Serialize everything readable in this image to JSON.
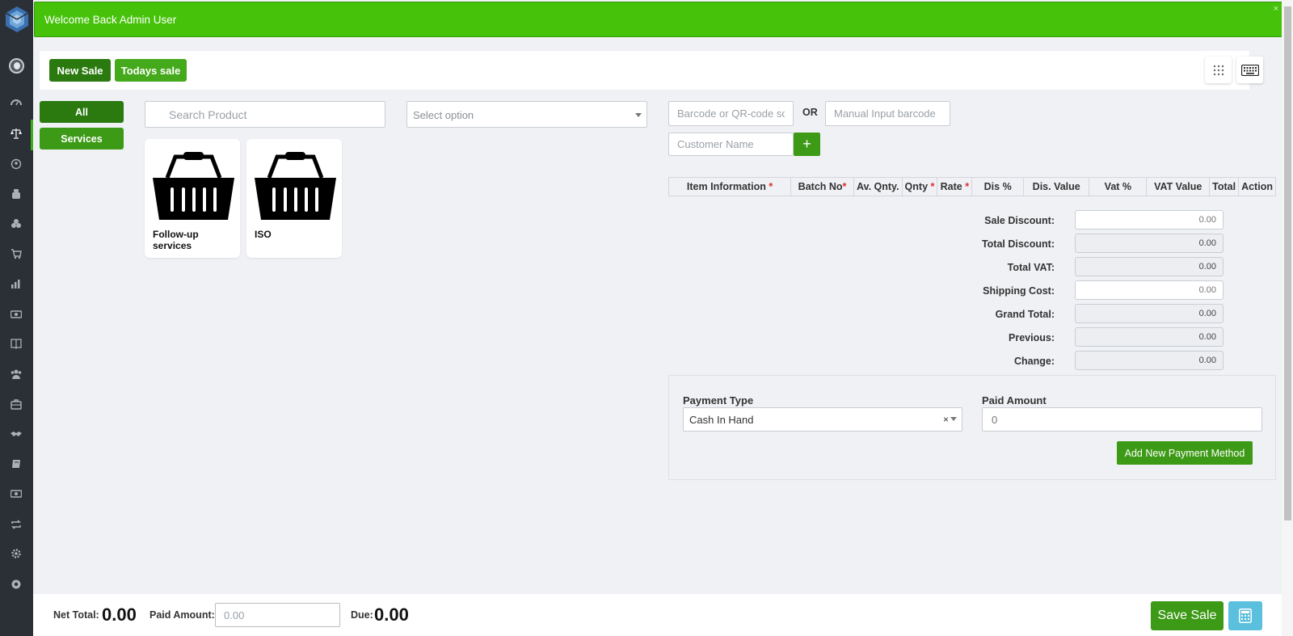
{
  "alert": {
    "message": "Welcome Back Admin User",
    "close": "×"
  },
  "toolbar": {
    "new_sale": "New Sale",
    "todays_sale": "Todays sale"
  },
  "categories": [
    "All",
    "Services"
  ],
  "search": {
    "placeholder": "Search Product"
  },
  "category_select": {
    "value": "Select option"
  },
  "products": [
    {
      "name": "Follow-up services",
      "icon": "shopping-basket-icon"
    },
    {
      "name": "ISO",
      "icon": "shopping-basket-icon"
    }
  ],
  "barcode": {
    "placeholder": "Barcode or QR-code scan here",
    "or_label": "OR",
    "manual_placeholder": "Manual Input barcode"
  },
  "customer": {
    "placeholder": "Customer Name",
    "add": "+"
  },
  "items_table": {
    "headers": [
      {
        "label": "Item Information",
        "required": true
      },
      {
        "label": "Batch No",
        "required": true,
        "tight": true
      },
      {
        "label": "Av. Qnty.",
        "required": false
      },
      {
        "label": "Qnty",
        "required": true
      },
      {
        "label": "Rate",
        "required": true
      },
      {
        "label": "Dis %",
        "required": false
      },
      {
        "label": "Dis. Value",
        "required": false
      },
      {
        "label": "Vat %",
        "required": false
      },
      {
        "label": "VAT Value",
        "required": false
      },
      {
        "label": "Total",
        "required": false
      },
      {
        "label": "Action",
        "required": false
      }
    ]
  },
  "totals": [
    {
      "label": "Sale Discount:",
      "value": "0.00",
      "readonly": false
    },
    {
      "label": "Total Discount:",
      "value": "0.00",
      "readonly": true
    },
    {
      "label": "Total VAT:",
      "value": "0.00",
      "readonly": true
    },
    {
      "label": "Shipping Cost:",
      "value": "0.00",
      "readonly": false
    },
    {
      "label": "Grand Total:",
      "value": "0.00",
      "readonly": true
    },
    {
      "label": "Previous:",
      "value": "0.00",
      "readonly": true
    },
    {
      "label": "Change:",
      "value": "0.00",
      "readonly": true
    }
  ],
  "payment": {
    "type_label": "Payment Type",
    "type_value": "Cash In Hand",
    "clear": "×",
    "amount_label": "Paid Amount",
    "amount_value": "0",
    "add_method": "Add New Payment Method"
  },
  "footer": {
    "net_total_label": "Net Total:",
    "net_total_value": "0.00",
    "paid_label": "Paid Amount:",
    "paid_placeholder": "0.00",
    "due_label": "Due:",
    "due_value": "0.00",
    "save": "Save Sale"
  },
  "colors": {
    "primary_green": "#3d9a16",
    "alert_green": "#46c20a",
    "sidebar": "#2b3036",
    "calc": "#5bc0de"
  },
  "sidebar_icons": [
    "dashboard-icon",
    "sale-icon",
    "customer-icon",
    "product-icon",
    "supplier-icon",
    "purchase-icon",
    "report-icon",
    "money-icon",
    "book-icon",
    "users-icon",
    "store-icon",
    "handshake-icon",
    "ledger-icon",
    "bank-icon",
    "return-icon",
    "settings-icon",
    "support-icon"
  ]
}
